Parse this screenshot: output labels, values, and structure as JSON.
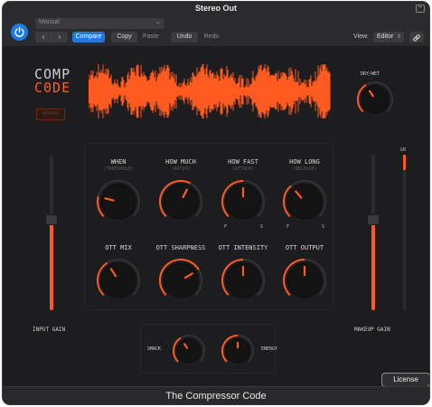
{
  "window": {
    "title": "Stereo Out"
  },
  "header": {
    "preset": "Manual",
    "compare": "Compare",
    "copy": "Copy",
    "paste": "Paste",
    "undo": "Undo",
    "redo": "Redo",
    "view_label": "View:",
    "view_value": "Editor"
  },
  "plugin": {
    "logo_line1": "COMP",
    "logo_line2": "C0DE",
    "bypass": "BYPASS",
    "dry_wet": "DRY/WET",
    "input_gain": "INPUT GAIN",
    "makeup_gain": "MAKEUP GAIN",
    "gr": "GR",
    "accent": "#ff5a1f",
    "knobs_row1": [
      {
        "label": "WHEN",
        "sub": "(THRESHOLD)",
        "value": 0.22
      },
      {
        "label": "HOW MUCH",
        "sub": "(RATIO)",
        "value": 0.6
      },
      {
        "label": "HOW FAST",
        "sub": "(ATTACK)",
        "value": 0.5,
        "left_mark": "F",
        "right_mark": "S"
      },
      {
        "label": "HOW LONG",
        "sub": "(RELEASE)",
        "value": 0.35,
        "left_mark": "F",
        "right_mark": "S"
      }
    ],
    "knobs_row2": [
      {
        "label": "OTT MIX",
        "value": 0.38
      },
      {
        "label": "OTT SHARPNESS",
        "value": 0.72
      },
      {
        "label": "OTT INTENSITY",
        "value": 0.5
      },
      {
        "label": "OTT OUTPUT",
        "value": 0.5
      }
    ],
    "smack": {
      "label": "SMACK",
      "value": 0.38
    },
    "energy": {
      "label": "ENERGY",
      "value": 0.5
    },
    "dry_wet_value": 0.38,
    "input_gain_value": 0.58,
    "makeup_gain_value": 0.58,
    "gr_value": 0.9
  },
  "footer": {
    "title": "The Compressor Code",
    "license": "License"
  }
}
